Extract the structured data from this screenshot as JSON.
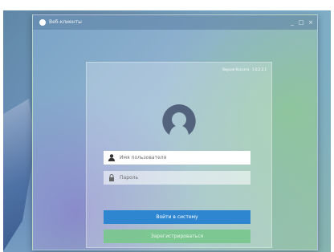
{
  "caption": {
    "text": ""
  },
  "window": {
    "title": "Веб-клиенты",
    "controls": {
      "minimize": "_",
      "maximize": "□",
      "close": "×"
    }
  },
  "login": {
    "version_text": "Версия Кассата · 1.0.2.2.1",
    "username": {
      "placeholder": "Имя пользователя",
      "value": "",
      "icon": "user-icon"
    },
    "password": {
      "placeholder": "Пароль",
      "value": "",
      "icon": "lock-icon"
    },
    "login_button": "Войти в систему",
    "register_button": "Зарегистрироваться",
    "avatar_icon": "user-avatar-icon"
  },
  "colors": {
    "login_button": "#2f86d0",
    "register_button": "#78c88c"
  }
}
